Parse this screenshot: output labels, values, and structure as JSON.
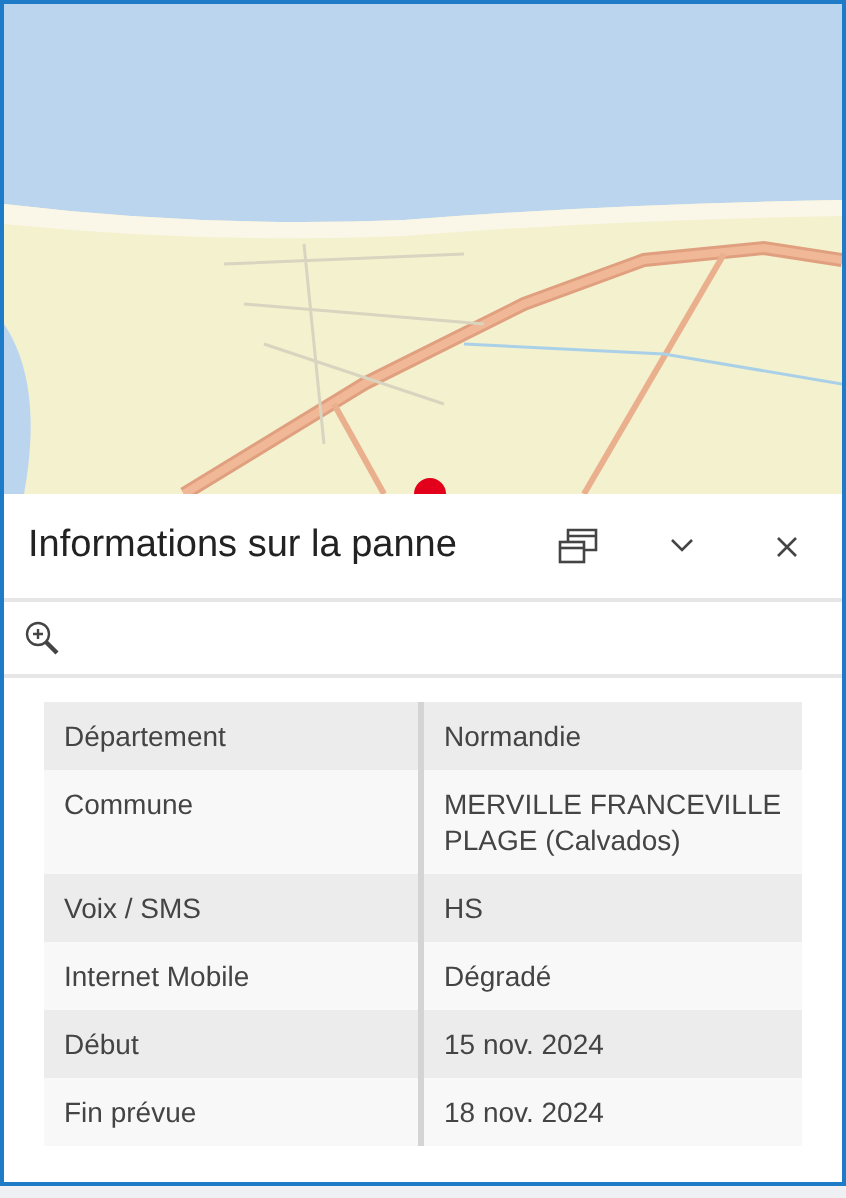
{
  "panel": {
    "title": "Informations sur la panne"
  },
  "table": {
    "rows": [
      {
        "label": "Département",
        "value": "Normandie"
      },
      {
        "label": "Commune",
        "value": "MERVILLE FRANCEVILLE PLAGE (Calvados)"
      },
      {
        "label": "Voix / SMS",
        "value": "HS"
      },
      {
        "label": "Internet Mobile",
        "value": "Dégradé"
      },
      {
        "label": "Début",
        "value": "15 nov. 2024"
      },
      {
        "label": "Fin prévue",
        "value": "18 nov. 2024"
      }
    ]
  }
}
